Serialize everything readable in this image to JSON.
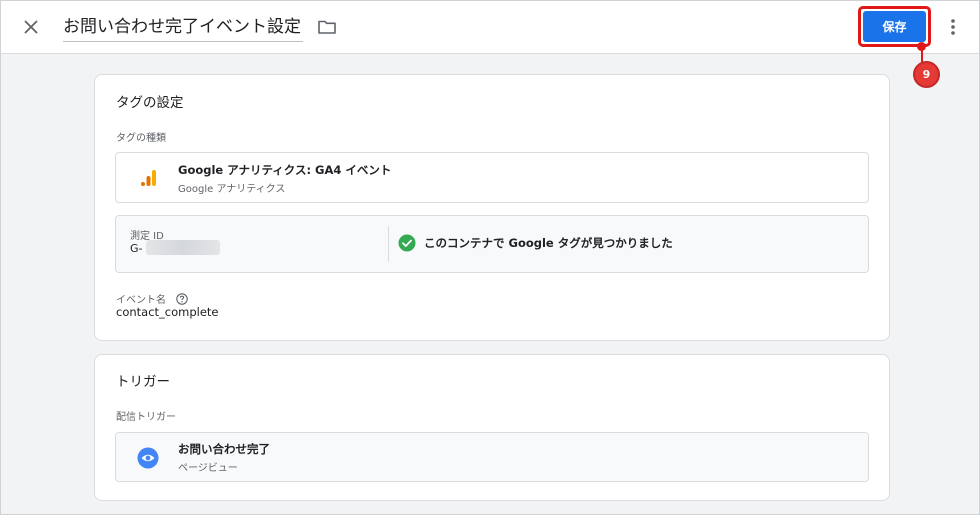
{
  "header": {
    "title": "お問い合わせ完了イベント設定",
    "save_label": "保存",
    "callout_number": "9"
  },
  "tag_config": {
    "title": "タグの設定",
    "type_label": "タグの種類",
    "type_name": "Google アナリティクス: GA4 イベント",
    "type_sub": "Google アナリティクス",
    "measurement_label": "測定 ID",
    "measurement_value": "G-",
    "found_message": "このコンテナで Google タグが見つかりました",
    "event_label": "イベント名",
    "event_value": "contact_complete"
  },
  "trigger": {
    "title": "トリガー",
    "firing_label": "配信トリガー",
    "name": "お問い合わせ完了",
    "sub": "ページビュー"
  },
  "colors": {
    "accent": "#1a73e8",
    "highlight": "#e01818",
    "success": "#34a853",
    "ga_orange": "#f9ab00",
    "ga_dark": "#e37400"
  },
  "icons": [
    "close-icon",
    "folder-icon",
    "more-vert-icon",
    "analytics-icon",
    "check-circle-icon",
    "help-icon",
    "eye-icon"
  ]
}
